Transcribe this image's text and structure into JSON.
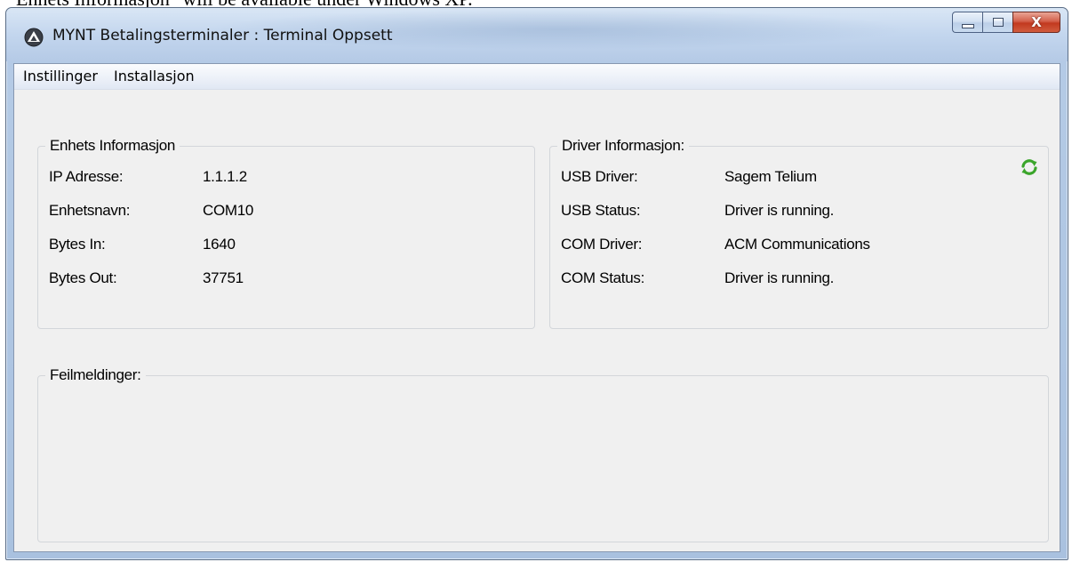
{
  "document_caption": "Enhets Informasjon\" will be available under Windows XP.",
  "window": {
    "title": "MYNT Betalingsterminaler : Terminal Oppsett",
    "app_icon": "mynt-logo-icon",
    "controls": {
      "minimize_icon": "minimize-icon",
      "maximize_icon": "maximize-icon",
      "close_icon": "close-icon",
      "close_glyph": "X"
    }
  },
  "menu": {
    "items": [
      {
        "label": "Instillinger"
      },
      {
        "label": "Installasjon"
      }
    ]
  },
  "device_info": {
    "title": "Enhets Informasjon",
    "rows": [
      {
        "label": "IP Adresse:",
        "value": "1.1.1.2"
      },
      {
        "label": "Enhetsnavn:",
        "value": "COM10"
      },
      {
        "label": "Bytes In:",
        "value": "1640"
      },
      {
        "label": "Bytes Out:",
        "value": "37751"
      }
    ]
  },
  "driver_info": {
    "title": "Driver Informasjon:",
    "refresh_icon": "refresh-icon",
    "rows": [
      {
        "label": "USB Driver:",
        "value": "Sagem Telium"
      },
      {
        "label": "USB Status:",
        "value": "Driver is running."
      },
      {
        "label": "COM Driver:",
        "value": "ACM Communications"
      },
      {
        "label": "COM Status:",
        "value": "Driver is running."
      }
    ]
  },
  "errors": {
    "title": "Feilmeldinger:"
  },
  "colors": {
    "client_background": "#f0f0f0",
    "refresh_green": "#3aa52a",
    "close_red": "#c2391f"
  }
}
